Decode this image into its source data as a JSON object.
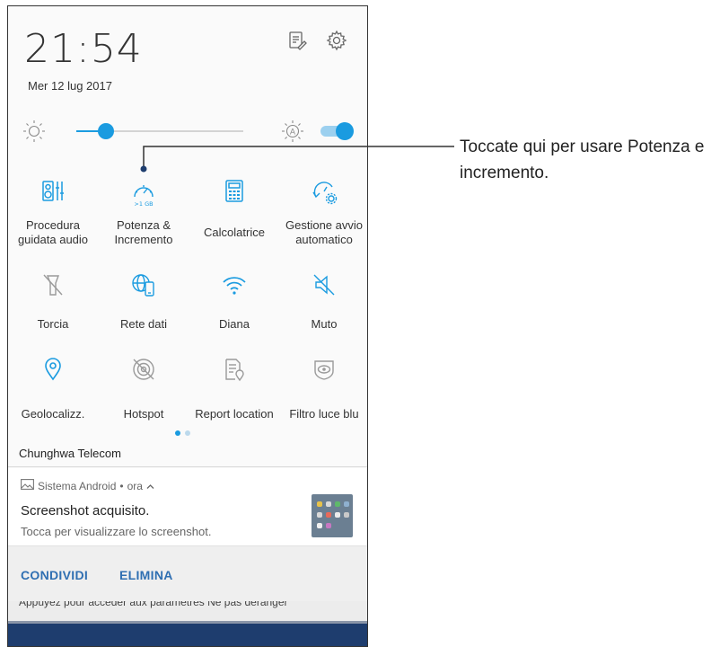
{
  "status": {
    "time": "21:54",
    "date": "Mer 12 lug 2017"
  },
  "top_icons": [
    "edit-notes-icon",
    "settings-gear-icon"
  ],
  "brightness": {
    "level": 0.18,
    "auto_enabled": true,
    "auto_label": "A"
  },
  "tiles": [
    {
      "label": "Procedura guidata audio",
      "icon": "audio-wizard-icon",
      "active": true
    },
    {
      "label": "Potenza & Incremento",
      "icon": "speedometer-icon",
      "active": true,
      "badge": ">1 GB"
    },
    {
      "label": "Calcolatrice",
      "icon": "calculator-icon",
      "active": true
    },
    {
      "label": "Gestione avvio automatico",
      "icon": "auto-start-icon",
      "active": true
    },
    {
      "label": "Torcia",
      "icon": "flashlight-off-icon",
      "active": false
    },
    {
      "label": "Rete dati",
      "icon": "mobile-data-icon",
      "active": true
    },
    {
      "label": "Diana",
      "icon": "wifi-icon",
      "active": true
    },
    {
      "label": "Muto",
      "icon": "mute-icon",
      "active": true
    },
    {
      "label": "Geolocalizz.",
      "icon": "location-pin-icon",
      "active": true
    },
    {
      "label": "Hotspot",
      "icon": "hotspot-off-icon",
      "active": false
    },
    {
      "label": "Report location",
      "icon": "report-location-icon",
      "active": false
    },
    {
      "label": "Filtro luce blu",
      "icon": "blue-light-filter-icon",
      "active": false
    }
  ],
  "pager": {
    "pages": 2,
    "current": 1
  },
  "carrier": "Chunghwa Telecom",
  "notification": {
    "app": "Sistema Android",
    "separator": "•",
    "time": "ora",
    "title": "Screenshot acquisito.",
    "text": "Tocca per visualizzare lo screenshot.",
    "actions": [
      "CONDIVIDI",
      "ELIMINA"
    ]
  },
  "behind_text": "Appuyez pour accéder aux paramètres Ne pas déranger",
  "callout": "Toccate qui per usare Potenza e incremento.",
  "colors": {
    "accent": "#1a9be0",
    "inactive": "#9a9a9a",
    "action": "#2f6fb2",
    "bottom_bar": "#1e3d6e"
  }
}
